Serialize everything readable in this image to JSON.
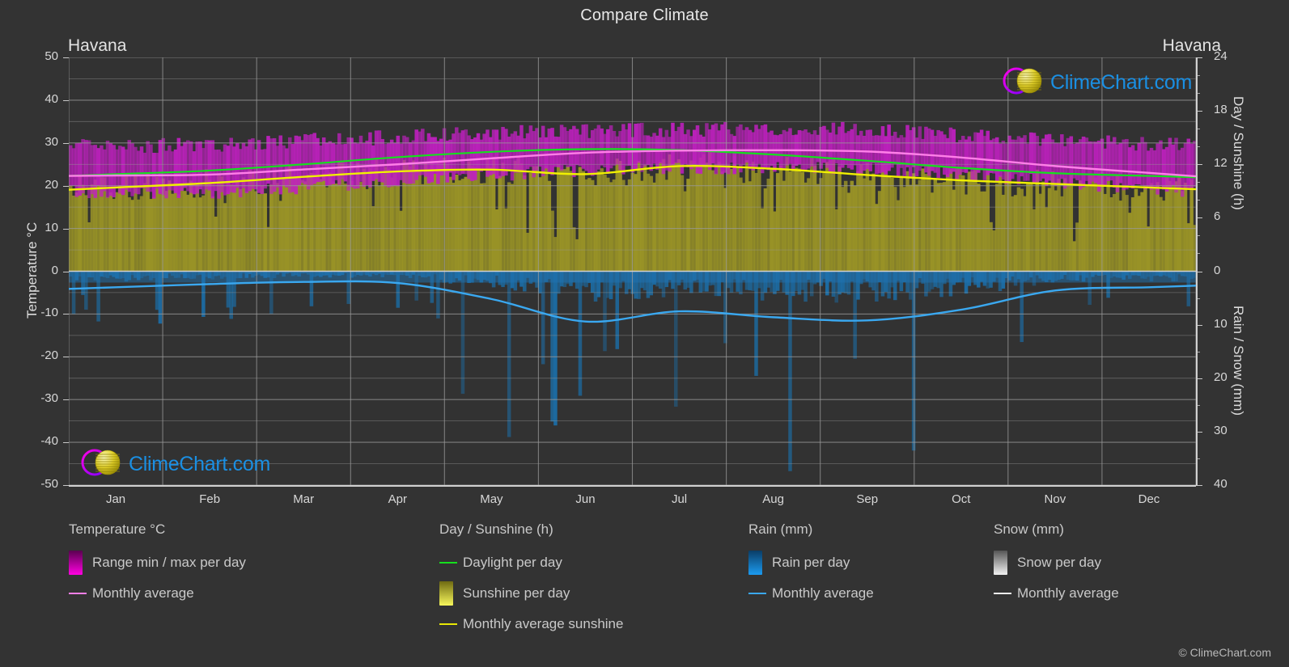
{
  "header": {
    "title": "Compare Climate",
    "city_left": "Havana",
    "city_right": "Havana"
  },
  "axes": {
    "left_title": "Temperature °C",
    "right_title_top": "Day / Sunshine (h)",
    "right_title_bottom": "Rain / Snow (mm)",
    "left_ticks": [
      "50",
      "40",
      "30",
      "20",
      "10",
      "0",
      "-10",
      "-20",
      "-30",
      "-40",
      "-50"
    ],
    "right_ticks_top": [
      "24",
      "18",
      "12",
      "6",
      "0"
    ],
    "right_ticks_bottom": [
      "10",
      "20",
      "30",
      "40"
    ],
    "x_ticks": [
      "Jan",
      "Feb",
      "Mar",
      "Apr",
      "May",
      "Jun",
      "Jul",
      "Aug",
      "Sep",
      "Oct",
      "Nov",
      "Dec"
    ]
  },
  "legend": {
    "columns": [
      {
        "heading": "Temperature °C",
        "items": [
          {
            "label": "Range min / max per day",
            "marker": "swatch",
            "color": "#ff00e0",
            "color2": "#5a0050"
          },
          {
            "label": "Monthly average",
            "marker": "line",
            "color": "#ff7fe8"
          }
        ]
      },
      {
        "heading": "Day / Sunshine (h)",
        "items": [
          {
            "label": "Daylight per day",
            "marker": "line",
            "color": "#15e01e"
          },
          {
            "label": "Sunshine per day",
            "marker": "swatch",
            "color": "#f7f75c",
            "color2": "#6f6a12"
          },
          {
            "label": "Monthly average sunshine",
            "marker": "line",
            "color": "#e8e805"
          }
        ]
      },
      {
        "heading": "Rain (mm)",
        "items": [
          {
            "label": "Rain per day",
            "marker": "swatch",
            "color": "#1b9bf0",
            "color2": "#0a3d66"
          },
          {
            "label": "Monthly average",
            "marker": "line",
            "color": "#3aa8f0"
          }
        ]
      },
      {
        "heading": "Snow (mm)",
        "items": [
          {
            "label": "Snow per day",
            "marker": "swatch",
            "color": "#f2f2f2",
            "color2": "#555555"
          },
          {
            "label": "Monthly average",
            "marker": "line",
            "color": "#f0f0f0"
          }
        ]
      }
    ]
  },
  "branding": {
    "logo_text": "ClimeChart.com",
    "copyright": "© ClimeChart.com"
  },
  "colors": {
    "page_background": "#333333",
    "plot_background": "#323232",
    "grid": "#8c8c8c",
    "text": "#d8d8d8",
    "temp_range": "#c020c0",
    "temp_avg": "#ff7fe8",
    "daylight": "#15e01e",
    "sunshine_fill": "#9a9426",
    "sunshine_avg": "#f0f000",
    "rain_fill": "#1b6ea8",
    "rain_avg": "#3aa8f0",
    "logo_blue": "#1a8fe3"
  },
  "chart_data": {
    "type": "area",
    "title": "Compare Climate",
    "subtitle": "Havana",
    "xlabel": "",
    "ylabel": "Temperature °C",
    "y2label_top": "Day / Sunshine (h)",
    "y2label_bottom": "Rain / Snow (mm)",
    "ylim": [
      -50,
      50
    ],
    "y2lim_top": [
      0,
      24
    ],
    "y2lim_bottom": [
      0,
      40
    ],
    "grid": true,
    "legend_position": "below",
    "categories": [
      "Jan",
      "Feb",
      "Mar",
      "Apr",
      "May",
      "Jun",
      "Jul",
      "Aug",
      "Sep",
      "Oct",
      "Nov",
      "Dec"
    ],
    "series": [
      {
        "name": "Monthly average temperature (°C)",
        "color": "#ff7fe8",
        "units": "°C",
        "values": [
          22.4,
          22.6,
          23.8,
          25.0,
          26.4,
          27.7,
          28.2,
          28.3,
          28.0,
          26.6,
          24.6,
          23.0
        ]
      },
      {
        "name": "Daily max temperature range top (°C)",
        "color": "#c020c0",
        "units": "°C",
        "values": [
          28.5,
          28.8,
          29.8,
          30.6,
          31.4,
          32.0,
          32.4,
          32.6,
          32.2,
          31.0,
          29.8,
          28.8
        ]
      },
      {
        "name": "Daily min temperature range bottom (°C)",
        "color": "#c020c0",
        "units": "°C",
        "values": [
          19.0,
          19.0,
          20.2,
          21.6,
          23.0,
          24.2,
          24.6,
          24.7,
          24.4,
          23.2,
          21.4,
          19.8
        ]
      },
      {
        "name": "Daylight per day (h)",
        "color": "#15e01e",
        "units": "h",
        "values": [
          10.9,
          11.3,
          12.0,
          12.8,
          13.4,
          13.7,
          13.6,
          13.1,
          12.4,
          11.6,
          11.0,
          10.7
        ]
      },
      {
        "name": "Monthly average sunshine (h)",
        "color": "#f0f000",
        "units": "h",
        "values": [
          9.4,
          9.9,
          10.6,
          11.2,
          11.4,
          10.9,
          11.8,
          11.5,
          10.8,
          10.2,
          9.8,
          9.4
        ]
      },
      {
        "name": "Monthly average rain (mm)",
        "color": "#3aa8f0",
        "units": "mm",
        "values": [
          3.0,
          2.4,
          2.0,
          2.2,
          5.2,
          9.4,
          7.5,
          8.6,
          9.2,
          7.2,
          3.6,
          3.0
        ]
      },
      {
        "name": "Monthly average snow (mm)",
        "color": "#f0f0f0",
        "units": "mm",
        "values": [
          0,
          0,
          0,
          0,
          0,
          0,
          0,
          0,
          0,
          0,
          0,
          0
        ]
      }
    ]
  }
}
